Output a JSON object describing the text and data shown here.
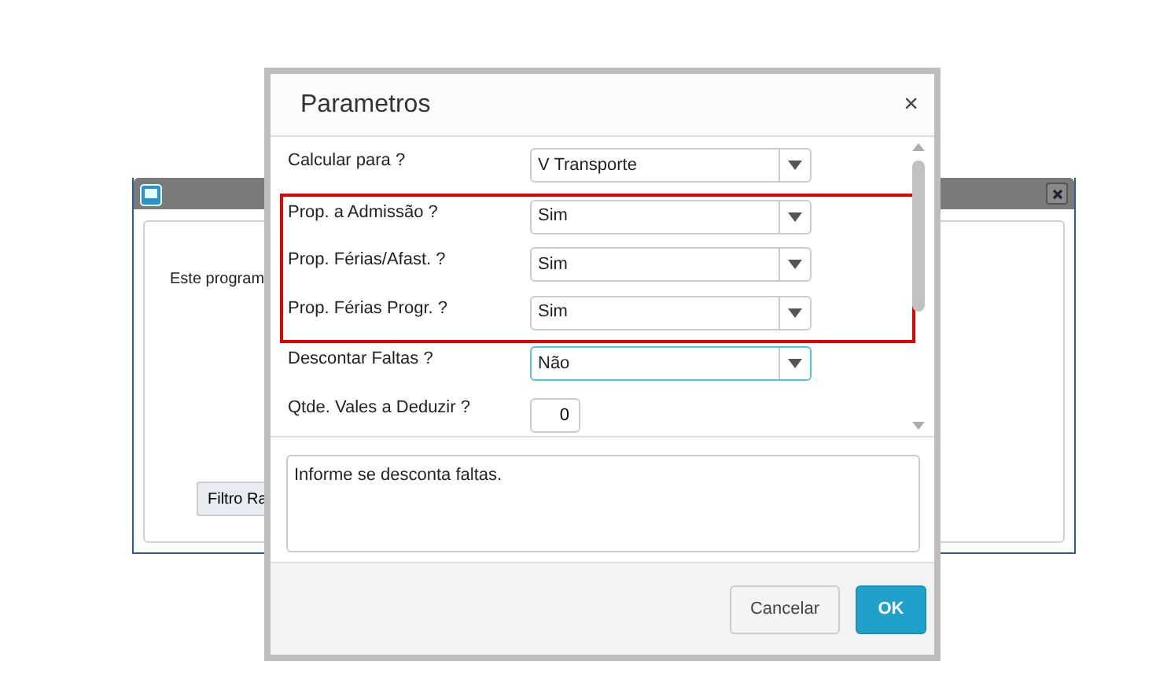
{
  "background_window": {
    "text": "Este program",
    "button": "Filtro Ra"
  },
  "dialog": {
    "title": "Parametros",
    "close": "×",
    "fields": [
      {
        "kind": "select",
        "label": "Calcular para ?",
        "value": "V Transporte",
        "highlighted": false,
        "focused": false
      },
      {
        "kind": "select",
        "label": "Prop. a Admissão ?",
        "value": "Sim",
        "highlighted": true,
        "focused": false
      },
      {
        "kind": "select",
        "label": "Prop. Férias/Afast. ?",
        "value": "Sim",
        "highlighted": true,
        "focused": false
      },
      {
        "kind": "select",
        "label": "Prop. Férias Progr. ?",
        "value": "Sim",
        "highlighted": true,
        "focused": false
      },
      {
        "kind": "select",
        "label": "Descontar Faltas ?",
        "value": "Não",
        "highlighted": false,
        "focused": true
      },
      {
        "kind": "number",
        "label": "Qtde. Vales a Deduzir ?",
        "value": "0",
        "highlighted": false,
        "focused": false
      }
    ],
    "help_text": "Informe se desconta faltas.",
    "buttons": [
      {
        "label": "Cancelar",
        "kind": "secondary"
      },
      {
        "label": "OK",
        "kind": "primary"
      }
    ]
  }
}
